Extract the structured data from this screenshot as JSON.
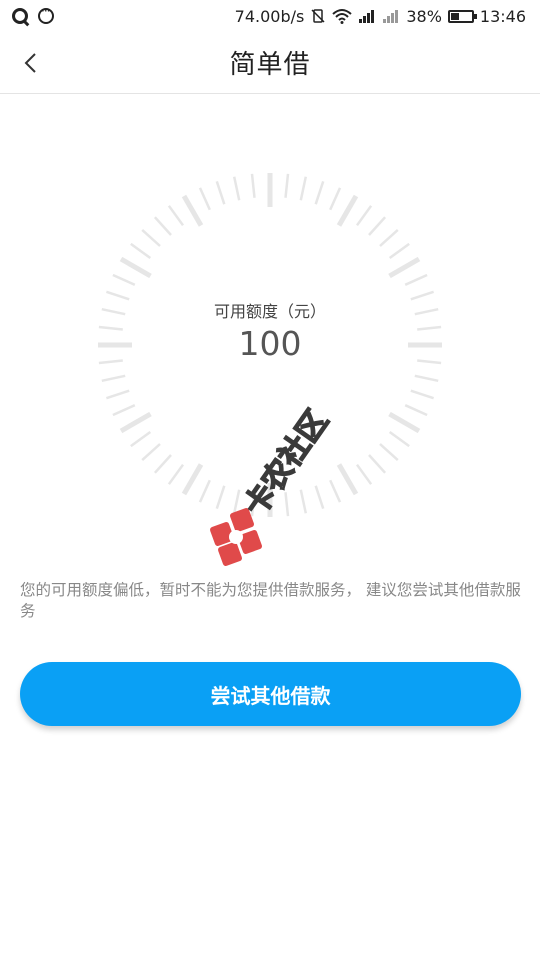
{
  "status_bar": {
    "network_speed": "74.00b/s",
    "battery_percent": "38%",
    "battery_level": 0.38,
    "time": "13:46",
    "left_icons": [
      "qq-icon",
      "chat-bubble-icon"
    ],
    "right_icons": [
      "vibrate-off-icon",
      "wifi-icon",
      "signal-icon",
      "signal-weak-icon",
      "battery-icon"
    ]
  },
  "nav": {
    "title": "简单借",
    "back_icon": "chevron-left-icon"
  },
  "gauge": {
    "label": "可用额度（元）",
    "value": "100"
  },
  "watermark": {
    "text": "卡农社区"
  },
  "notice": {
    "text": "您的可用额度偏低，暂时不能为您提供借款服务， 建议您尝试其他借款服务"
  },
  "actions": {
    "primary_label": "尝试其他借款"
  },
  "colors": {
    "accent": "#0aa0f5",
    "tick": "#e6e6e6",
    "watermark_red": "#e04a4a"
  }
}
